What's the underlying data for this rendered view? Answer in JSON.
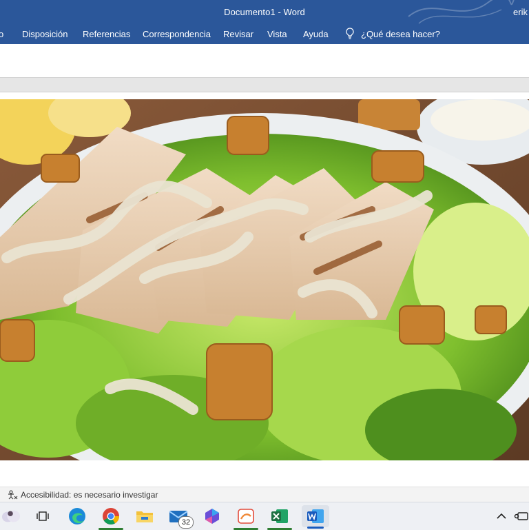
{
  "window": {
    "title": "Documento1  -  Word",
    "user": "erik"
  },
  "ribbon": {
    "tabs": [
      {
        "label": "o"
      },
      {
        "label": "Disposición"
      },
      {
        "label": "Referencias"
      },
      {
        "label": "Correspondencia"
      },
      {
        "label": "Revisar"
      },
      {
        "label": "Vista"
      },
      {
        "label": "Ayuda"
      }
    ],
    "tell_me": "¿Qué desea hacer?"
  },
  "document": {
    "image": "caesar-salad-photo"
  },
  "status_bar": {
    "accessibility": "Accesibilidad: es necesario investigar"
  },
  "taskbar": {
    "mail_badge": "32",
    "icons": [
      "copilot-icon",
      "task-view-icon",
      "edge-icon",
      "chrome-icon",
      "file-explorer-icon",
      "mail-icon",
      "m365-icon",
      "sketch-app-icon",
      "excel-icon",
      "word-icon"
    ]
  },
  "colors": {
    "word_blue": "#2b579a",
    "excel_green": "#1d6f42"
  }
}
